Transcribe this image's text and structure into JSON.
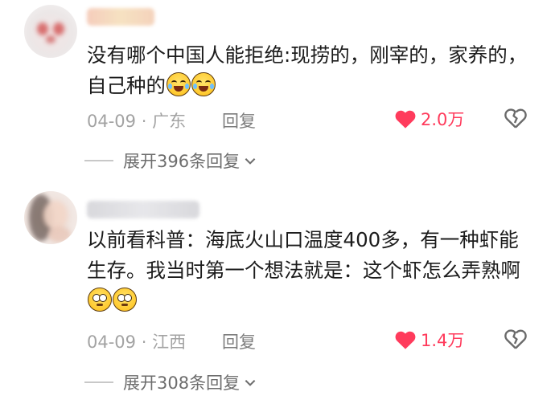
{
  "comments": [
    {
      "text": "没有哪个中国人能拒绝:现捞的，刚宰的，家养的，自己种的",
      "emojis": [
        "laugh-cry-emoji",
        "laugh-cry-emoji"
      ],
      "date": "04-09",
      "separator": "·",
      "location": "广东",
      "reply_label": "回复",
      "likes": "2.0万",
      "expand_label": "展开396条回复"
    },
    {
      "text": "以前看科普：海底火山口温度400多，有一种虾能生存。我当时第一个想法就是：这个虾怎么弄熟啊",
      "emojis": [
        "thinking-emoji",
        "thinking-emoji"
      ],
      "date": "04-09",
      "separator": "·",
      "location": "江西",
      "reply_label": "回复",
      "likes": "1.4万",
      "expand_label": "展开308条回复"
    }
  ],
  "colors": {
    "like": "#ff3b5c",
    "meta": "#a3a3a3",
    "text": "#1c1c1c"
  }
}
